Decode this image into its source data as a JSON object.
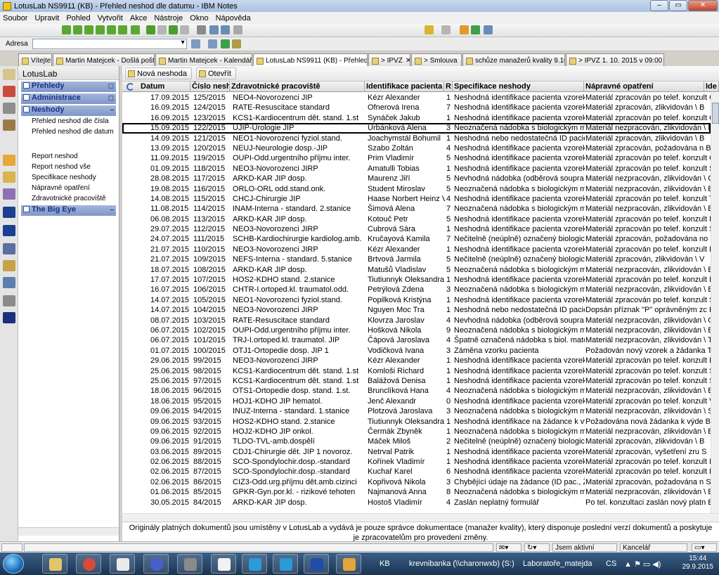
{
  "window": {
    "title": "LotusLab NS9911 (KB) - Přehled neshod dle datumu - IBM Notes",
    "btn_minimize": "–",
    "btn_maximize": "▭",
    "btn_close": "✕"
  },
  "menu": [
    "Soubor",
    "Upravit",
    "Pohled",
    "Vytvořit",
    "Akce",
    "Nástroje",
    "Okno",
    "Nápověda"
  ],
  "address": {
    "label": "Adresa",
    "value": ""
  },
  "tabs": [
    {
      "label": "Vítejte",
      "active": false
    },
    {
      "label": "Martin Matejcek - Došlá pošta",
      "active": false
    },
    {
      "label": "Martin Matejcek - Kalendář",
      "active": false
    },
    {
      "label": "LotusLab NS9911 (KB) - Přehled ...",
      "active": true
    },
    {
      "label": "> IPVZ",
      "active": false
    },
    {
      "label": "> Smlouva",
      "active": false
    },
    {
      "label": "schůze manažerů kvality 9.10.",
      "active": false
    },
    {
      "label": "> IPVZ 1. 10. 2015 v 09:00",
      "active": false
    }
  ],
  "nav": {
    "app_title": "LotusLab",
    "sections": {
      "prehledy": "Přehledy",
      "administrace": "Administrace",
      "neshody": "Neshody",
      "bigeye": "The Big Eye"
    },
    "items_top": [
      "Přehled neshod dle čísla",
      "Přehled neshod dle datum"
    ],
    "items_bottom": [
      "Report neshod",
      "Report neshod vše",
      "Specifikace neshody",
      "Nápravné opatření",
      "Zdravotnické pracoviště"
    ]
  },
  "actions": {
    "new": "Nová neshoda",
    "open": "Otevřít"
  },
  "columns": [
    "Datum",
    "Číslo neshod",
    "Zdravotnické pracoviště",
    "Identifikace pacienta",
    "R",
    "Specifikace neshody",
    "Nápravné opatření",
    "Ide"
  ],
  "rows": [
    [
      "17.09.2015",
      "125/2015",
      "NEO4-Novorozenci JIP",
      "Kézr Alexander",
      "1",
      "Neshodná identifikace pacienta vzorek",
      "Materiál zpracován po telef. konzult C"
    ],
    [
      "16.09.2015",
      "124/2015",
      "RATE-Resuscitace standard",
      "Ofnerová Irena",
      "7",
      "Neshodná identifikace pacienta vzorek",
      "Materiál zpracován, zlikvidován \\ B"
    ],
    [
      "16.09.2015",
      "123/2015",
      "KCS1-Kardiocentrum dět. stand. 1.st",
      "Synáček Jakub",
      "1",
      "Neshodná identifikace pacienta vzorek",
      "Materiál zpracován po telef. konzult C"
    ],
    [
      "15.09.2015",
      "122/2015",
      "UJIP-Urologie JIP",
      "Urbánková Alena",
      "3",
      "Neoznačená nádobka s biologickým m",
      "Materiál nezpracován, zlikvidován \\ B"
    ],
    [
      "14.09.2015",
      "121/2015",
      "NEO1-Novorozenci fyziol.stand.",
      "Joachymstál Bohumil",
      "1",
      "Neshodná nebo nedostatečná ID pacie",
      "Materiál zpracován, zlikvidován \\ B"
    ],
    [
      "13.09.2015",
      "120/2015",
      "NEUJ-Neurologie dosp.-JIP",
      "Szabo Zoltán",
      "4",
      "Neshodná identifikace pacienta vzorek",
      "Materiál zpracován, požadována n B"
    ],
    [
      "11.09.2015",
      "119/2015",
      "OUPI-Odd.urgentního příjmu inter.",
      "Prim Vladimír",
      "5",
      "Neshodná identifikace pacienta vzorek",
      "Materiál zpracován po telef. konzult C"
    ],
    [
      "01.09.2015",
      "118/2015",
      "NEO3-Novorozenci JIRP",
      "Amatulli Tobias",
      "1",
      "Neshodná identifikace pacienta vzorek",
      "Materiál zpracován po telef. konzult S"
    ],
    [
      "28.08.2015",
      "117/2015",
      "ARKD-KAR JIP dosp.",
      "Maurenz Jiří",
      "5",
      "Nevhodná nádobka (odběrová soupra",
      "Materiál nezpracován, zlikvidován \\ C"
    ],
    [
      "19.08.2015",
      "116/2015",
      "ORLO-ORL odd.stand.onk.",
      "Student Miroslav",
      "5",
      "Neoznačená nádobka s biologickým m",
      "Materiál nezpracován, zlikvidován \\ B"
    ],
    [
      "14.08.2015",
      "115/2015",
      "CHCJ-Chirurgie JIP",
      "Haase Norbert Heinz V",
      "4",
      "Neshodná identifikace pacienta vzorek",
      "Materiál zpracován po telef. konzult T"
    ],
    [
      "11.08.2015",
      "114/2015",
      "INAM-Interna - standard. 2.stanice",
      "Šimová Alena",
      "7",
      "Neoznačená nádobka s biologickým m",
      "Materiál nezpracován, zlikvidován \\ B"
    ],
    [
      "06.08.2015",
      "113/2015",
      "ARKD-KAR JIP dosp.",
      "Kotouč Petr",
      "5",
      "Neshodná identifikace pacienta vzorek",
      "Materiál zpracován po telef. konzult B"
    ],
    [
      "29.07.2015",
      "112/2015",
      "NEO3-Novorozenci JIRP",
      "Cubrová Sára",
      "1",
      "Neshodná identifikace pacienta vzorek",
      "Materiál zpracován po telef. konzult Š"
    ],
    [
      "24.07.2015",
      "111/2015",
      "SCHB-Kardiochirurgie kardiolog.amb.",
      "Kručayová Kamila",
      "7",
      "Nečitelně (neúplně) označený biologick",
      "Materiál zpracován, požadována no S"
    ],
    [
      "21.07.2015",
      "110/2015",
      "NEO3-Novorozenci JIRP",
      "Kézr Alexander",
      "1",
      "Neshodná identifikace pacienta vzorek",
      "Materiál zpracován po telef. konzult B"
    ],
    [
      "21.07.2015",
      "109/2015",
      "NEFS-Interna - standard. 5.stanice",
      "Brtvová Jarmila",
      "5",
      "Nečitelně (neúplně) označený biologick",
      "Materiál zpracován, zlikvidován \\ V"
    ],
    [
      "18.07.2015",
      "108/2015",
      "ARKD-KAR JIP dosp.",
      "Matušů Vladislav",
      "5",
      "Neoznačená nádobka s biologickým m",
      "Materiál nezpracován, zlikvidován \\ B"
    ],
    [
      "17.07.2015",
      "107/2015",
      "HOS2-KDHO stand. 2.stanice",
      "Tiutiunnyk Oleksandra",
      "1",
      "Neshodná identifikace pacienta vzorek",
      "Materiál zpracován po telef. konzult B"
    ],
    [
      "16.07.2015",
      "106/2015",
      "CHTR-I.ortoped.kl. traumatol.odd.",
      "Petrýlová Zdena",
      "3",
      "Neoznačená nádobka s biologickým m",
      "Materiál nezpracován, zlikvidován \\ B"
    ],
    [
      "14.07.2015",
      "105/2015",
      "NEO1-Novorozenci fyziol.stand.",
      "Popilková Kristýna",
      "1",
      "Neshodná identifikace pacienta vzorek",
      "Materiál zpracován po telef. konzult S"
    ],
    [
      "14.07.2015",
      "104/2015",
      "NEO3-Novorozenci JIRP",
      "Nguyen Moc Tra",
      "1",
      "Neshodná nebo nedostatečná ID pacie",
      "Dopsán příznak \"P\" oprávněným zc B"
    ],
    [
      "08.07.2015",
      "103/2015",
      "RATE-Resuscitace standard",
      "Klovrza Jaroslav",
      "4",
      "Nevhodná nádobka (odběrová soupra",
      "Materiál nezpracován, zlikvidován \\ C"
    ],
    [
      "06.07.2015",
      "102/2015",
      "OUPI-Odd.urgentního příjmu inter.",
      "Hošková Nikola",
      "9",
      "Neoznačená nádobka s biologickým m",
      "Materiál nezpracován, zlikvidován \\ B"
    ],
    [
      "06.07.2015",
      "101/2015",
      "TRJ-I.ortoped.kl. traumatol. JIP",
      "Čápová Jaroslava",
      "4",
      "Špatně označená nádobka s biol. mate",
      "Materiál nezpracován, zlikvidován \\ T"
    ],
    [
      "01.07.2015",
      "100/2015",
      "OTJ1-Ortopedie dosp. JIP 1",
      "Vodičková Ivana",
      "3",
      "Záměna vzorku pacienta",
      "Požadován nový vzorek a žádanka T"
    ],
    [
      "29.06.2015",
      "99/2015",
      "NEO3-Novorozenci JIRP",
      "Kézr Alexander",
      "1",
      "Neshodná identifikace pacienta vzorek",
      "Materiál zpracován po telef. konzult B"
    ],
    [
      "25.06.2015",
      "98/2015",
      "KCS1-Kardiocentrum dět. stand. 1.st",
      "Komloši Richard",
      "1",
      "Neshodná identifikace pacienta vzorek",
      "Materiál zpracován po telef. konzult S"
    ],
    [
      "25.06.2015",
      "97/2015",
      "KCS1-Kardiocentrum dět. stand. 1.st",
      "Balážová Denisa",
      "1",
      "Neshodná identifikace pacienta vzorek",
      "Materiál zpracován po telef. konzult S"
    ],
    [
      "18.06.2015",
      "96/2015",
      "OTS1-Ortopedie dosp. stand. 1.st.",
      "Brunclíková Hana",
      "4",
      "Neoznačená nádobka s biologickým m",
      "Materiál nezpracován, zlikvidován \\ B"
    ],
    [
      "18.06.2015",
      "95/2015",
      "HOJ1-KDHO JIP hematol.",
      "Jenč Alexandr",
      "0",
      "Neshodná identifikace pacienta vzorek",
      "Materiál zpracován po telef. konzult V"
    ],
    [
      "09.06.2015",
      "94/2015",
      "INUZ-Interna - standard. 1.stanice",
      "Plotzová Jaroslava",
      "3",
      "Neoznačená nádobka s biologickým m",
      "Materiál nezpracován, zlikvidován \\ S"
    ],
    [
      "09.06.2015",
      "93/2015",
      "HOS2-KDHO stand. 2.stanice",
      "Tiutiunnyk Oleksandra",
      "1",
      "Neshodná identifikace na žádance k vy",
      "Požadována nová žádanka k výde B"
    ],
    [
      "09.06.2015",
      "92/2015",
      "HOJ2-KDHO JIP onkol.",
      "Čermák Zbyněk",
      "1",
      "Neoznačená nádobka s biologickým m",
      "Materiál nezpracován, zlikvidován \\ B"
    ],
    [
      "09.06.2015",
      "91/2015",
      "TLDO-TVL-amb.dospělí",
      "Máček Miloš",
      "2",
      "Nečitelně (neúplně) označený biologick",
      "Materiál zpracován, zlikvidován \\ B"
    ],
    [
      "03.06.2015",
      "89/2015",
      "CDJ1-Chirurgie dět. JIP 1 novoroz.",
      "Netrval Patrik",
      "1",
      "Neshodná identifikace pacienta vzorek",
      "Materiál zpracován, vyšetření zru S"
    ],
    [
      "02.06.2015",
      "88/2015",
      "SCO-Spondylochir.dosp.-standard",
      "Kořínek Vladimír",
      "1",
      "Neshodná identifikace pacienta vzorek",
      "Materiál zpracován po telef. konzult B"
    ],
    [
      "02.06.2015",
      "87/2015",
      "SCO-Spondylochir.dosp.-standard",
      "Kuchař Karel",
      "6",
      "Neshodná identifikace pacienta vzorek",
      "Materiál zpracován po telef. konzult B"
    ],
    [
      "02.06.2015",
      "86/2015",
      "CIZ3-Odd.urg.příjmu dět.amb.cizinci",
      "Kopřivová Nikola",
      "3",
      "Chybějící údaje na žádance (ID pac., Ž",
      "Materiál zpracován, požadována n S"
    ],
    [
      "01.06.2015",
      "85/2015",
      "GPKR-Gyn.por.kl. - rizikové tehoten",
      "Najmanová Anna",
      "8",
      "Neoznačená nádobka s biologickým m",
      "Materiál nezpracován, zlikvidován \\ B"
    ],
    [
      "30.05.2015",
      "84/2015",
      "ARKD-KAR JIP dosp.",
      "Hostoš Vladimír",
      "4",
      "Zaslán neplatný formulář",
      "Po tel. konzultaci zaslán nový platn B"
    ]
  ],
  "footer": {
    "line1": "Originály platných dokumentů jsou umístěny v LotusLab a vydává je pouze správce dokumentace (manažer kvality), který disponuje poslední verzí dokumentů a poskytuje",
    "line2": "je zpracovatelům pro provedení změny."
  },
  "status": {
    "presence": "Jsem aktivní",
    "location": "Kancelář"
  },
  "taskbar": {
    "lang_left": "KB",
    "drive": "krevnibanka (\\\\charonwxb) (S:)",
    "workspace": "Laboratoře_matejda",
    "lang": "CS",
    "time": "15:44",
    "date": "29.9.2015"
  },
  "colors": {
    "nav_section": "#7f97c8",
    "nav_text": "#17338a",
    "taskbar": "#1b3453"
  }
}
